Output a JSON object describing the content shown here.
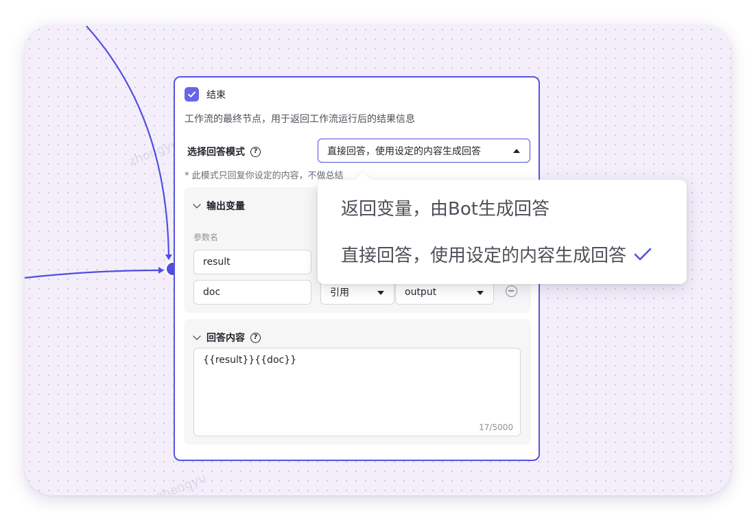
{
  "node": {
    "title": "结束",
    "description": "工作流的最终节点，用于返回工作流运行后的结果信息"
  },
  "answer_mode": {
    "label": "选择回答模式",
    "selected": "直接回答，使用设定的内容生成回答",
    "note": "* 此模式只回复你设定的内容，不做总结",
    "options": [
      "返回变量，由Bot生成回答",
      "直接回答，使用设定的内容生成回答"
    ]
  },
  "output_vars": {
    "title": "输出变量",
    "param_label": "参数名",
    "rows": [
      {
        "name": "result"
      },
      {
        "name": "doc",
        "type": "引用",
        "value": "output"
      }
    ]
  },
  "answer_content": {
    "title": "回答内容",
    "text": "{{result}}{{doc}}",
    "count": "17/5000"
  },
  "watermark": "zhongyu",
  "colors": {
    "accent": "#4f4ee0",
    "canvas": "#f3eefa"
  },
  "icons": [
    "checkbox-checked-icon",
    "help-icon",
    "chevron-down-icon",
    "caret-down-icon",
    "remove-icon",
    "check-icon"
  ]
}
